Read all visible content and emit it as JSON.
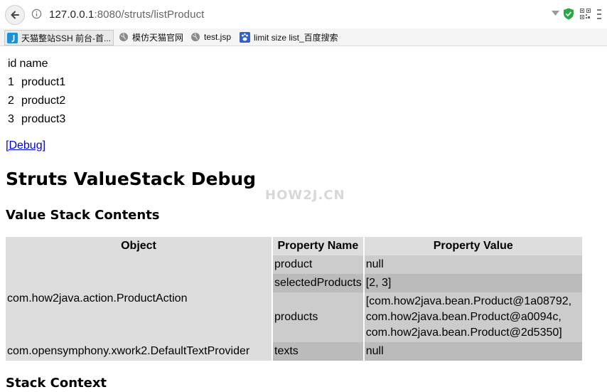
{
  "browser": {
    "url_host": "127.0.0.1",
    "url_rest": ":8080/struts/listProduct",
    "bookmarks": [
      {
        "label": "天猫整站SSH 前台-首...",
        "icon": "j-icon"
      },
      {
        "label": "模仿天猫官网",
        "icon": "globe-icon"
      },
      {
        "label": "test.jsp",
        "icon": "globe-icon"
      },
      {
        "label": "limit size list_百度搜索",
        "icon": "baidu-paw-icon"
      }
    ]
  },
  "products": {
    "header_id": "id",
    "header_name": "name",
    "rows": [
      {
        "id": "1",
        "name": "product1"
      },
      {
        "id": "2",
        "name": "product2"
      },
      {
        "id": "3",
        "name": "product3"
      }
    ]
  },
  "debug_link": "[Debug]",
  "debug": {
    "title": "Struts ValueStack Debug",
    "watermark": "HOW2J.CN",
    "value_stack_heading": "Value Stack Contents",
    "stack_context_heading": "Stack Context",
    "table": {
      "headers": [
        "Object",
        "Property Name",
        "Property Value"
      ],
      "objects": [
        {
          "name": "com.how2java.action.ProductAction",
          "props": [
            {
              "name": "product",
              "value": "null"
            },
            {
              "name": "selectedProducts",
              "value": "[2, 3]"
            },
            {
              "name": "products",
              "value_lines": [
                "[com.how2java.bean.Product@1a08792,",
                "com.how2java.bean.Product@a0094c,",
                "com.how2java.bean.Product@2d5350]"
              ]
            }
          ]
        },
        {
          "name": "com.opensymphony.xwork2.DefaultTextProvider",
          "props": [
            {
              "name": "texts",
              "value": "null"
            }
          ]
        }
      ]
    }
  }
}
